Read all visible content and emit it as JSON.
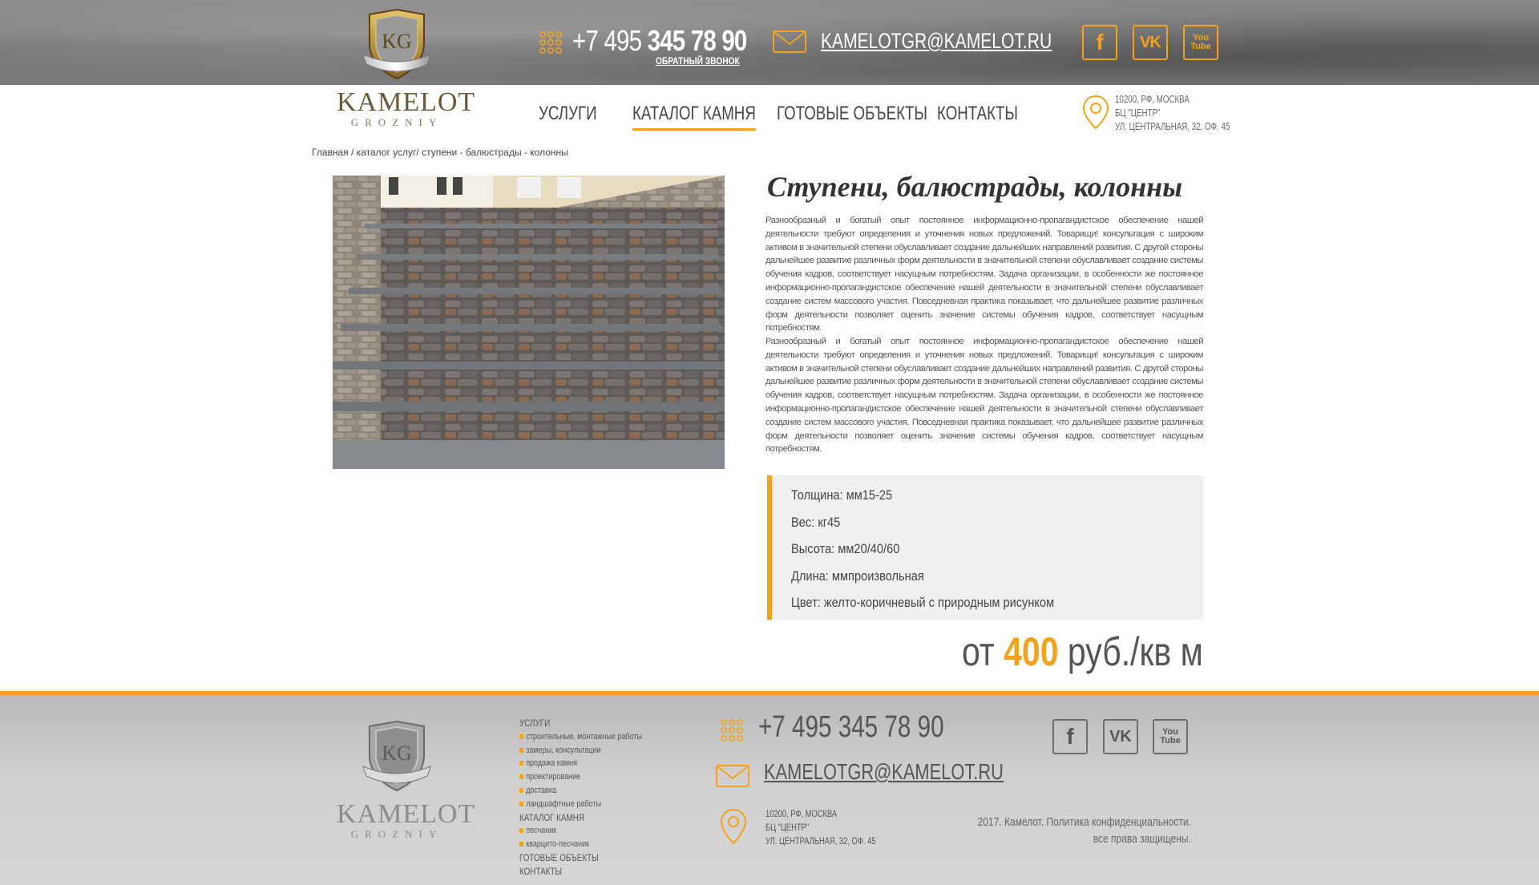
{
  "header": {
    "logo": {
      "name": "KAMELOT",
      "sub": "GROZNIY",
      "monogram": "KG"
    },
    "phone_prefix": "+7 495 ",
    "phone_main": "345 78 90",
    "callback": "ОБРАТНЫЙ ЗВОНОК",
    "email": "KAMELOTGR@KAMELOT.RU",
    "social": {
      "facebook": "f",
      "vk": "VK",
      "youtube_top": "You",
      "youtube_bottom": "Tube"
    }
  },
  "nav": {
    "items": [
      "УСЛУГИ",
      "КАТАЛОГ КАМНЯ",
      "ГОТОВЫЕ ОБЪЕКТЫ",
      "КОНТАКТЫ"
    ],
    "active_index": 1,
    "address": [
      "10200, РФ, МОСКВА",
      "БЦ \"ЦЕНТР\"",
      "УЛ. ЦЕНТРАЛЬНАЯ, 32, ОФ. 45"
    ]
  },
  "breadcrumb": "Главная / каталог услуг/ ступени - балюстрады - колонны",
  "product": {
    "title": "Ступени, балюстрады, колонны",
    "paragraphs": [
      "Разнообразный и богатый опыт постоянное информационно-пропагандистское обеспечение нашей деятельности требуют определения и уточнения новых предложений. Товарищи! консультация с широким активом в значительной степени обуславливает создание дальнейших направлений развития. С другой стороны дальнейшее развитие различных форм деятельности в значительной степени обуславливает создание системы обучения кадров, соответствует насущным потребностям. Задача организации, в особенности же постоянное информационно-пропагандистское обеспечение нашей деятельности в значительной степени обуславливает создание систем массового участия. Повседневная практика показывает, что дальнейшее развитие различных форм деятельности позволяет оценить значение системы обучения кадров, соответствует насущным потребностям.",
      "Разнообразный и богатый опыт постоянное информационно-пропагандистское обеспечение нашей деятельности требуют определения и уточнения новых предложений. Товарищи! консультация с широким активом в значительной степени обуславливает создание дальнейших направлений развития. С другой стороны дальнейшее развитие различных форм деятельности в значительной степени обуславливает создание системы обучения кадров, соответствует насущным потребностям. Задача организации, в особенности же постоянное информационно-пропагандистское обеспечение нашей деятельности в значительной степени обуславливает создание систем массового участия. Повседневная практика показывает, что дальнейшее развитие различных форм деятельности позволяет оценить значение системы обучения кадров, соответствует насущным потребностям."
    ],
    "specs": [
      "Толщина: мм15-25",
      "Вес: кг45",
      "Высота: мм20/40/60",
      "Длина: ммпроизвольная",
      "Цвет: желто-коричневый с природным рисунком"
    ],
    "price_prefix": "от ",
    "price_value": "400",
    "price_suffix": " руб./кв м"
  },
  "footer": {
    "menu": [
      {
        "head": "УСЛУГИ",
        "subs": [
          "строительные, монтажные работы",
          "замеры, консультации",
          "продажа камня",
          "проектирование",
          "доставка",
          "ландшафтные работы"
        ]
      },
      {
        "head": "КАТАЛОГ КАМНЯ",
        "subs": [
          "песчаник",
          "кварцито-песчаник"
        ]
      },
      {
        "head": "ГОТОВЫЕ ОБЪЕКТЫ",
        "subs": []
      },
      {
        "head": "КОНТАКТЫ",
        "subs": []
      }
    ],
    "phone": "+7 495 345 78 90",
    "email": "KAMELOTGR@KAMELOT.RU",
    "address": [
      "10200, РФ, МОСКВА",
      "БЦ \"ЦЕНТР\"",
      "УЛ. ЦЕНТРАЛЬНАЯ, 32, ОФ. 45"
    ],
    "copyright": [
      "2017. Камелот. Политика конфиденциальности.",
      "все права защищены."
    ]
  },
  "colors": {
    "accent": "#f2a31b",
    "text": "#3c3c3c",
    "header_bg": "#7a7a7a",
    "footer_bg": "#cfcfcf"
  },
  "icons": [
    "shield-logo-icon",
    "phone-dots-icon",
    "envelope-icon",
    "map-pin-icon",
    "facebook-icon",
    "vk-icon",
    "youtube-icon"
  ]
}
